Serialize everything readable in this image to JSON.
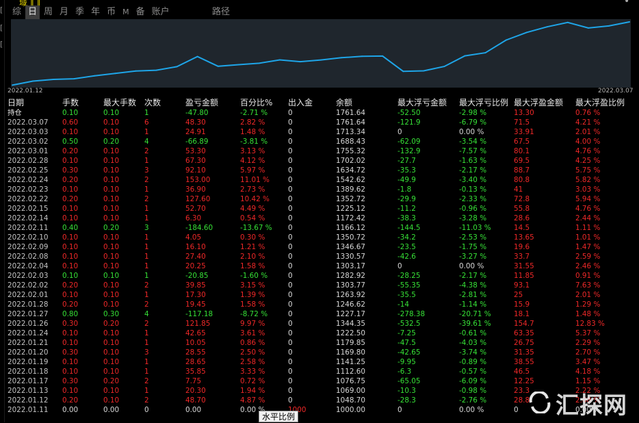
{
  "top": {
    "yellow_text": "域 ‖ ‖",
    "corner_mark": "•"
  },
  "tabs": [
    {
      "label": "综",
      "active": false
    },
    {
      "label": "日",
      "active": true
    },
    {
      "label": "周",
      "active": false
    },
    {
      "label": "月",
      "active": false
    },
    {
      "label": "季",
      "active": false
    },
    {
      "label": "年",
      "active": false
    },
    {
      "label": "币",
      "active": false
    },
    {
      "label": "M",
      "active": false
    },
    {
      "label": "备",
      "active": false
    },
    {
      "label": "账户",
      "active": false
    }
  ],
  "path_tab": "路径",
  "chart_data": {
    "type": "line",
    "x": [
      "2022.01.11",
      "2022.01.12",
      "2022.01.13",
      "2022.01.17",
      "2022.01.18",
      "2022.01.19",
      "2022.01.20",
      "2022.01.21",
      "2022.01.24",
      "2022.01.26",
      "2022.01.27",
      "2022.01.28",
      "2022.02.01",
      "2022.02.02",
      "2022.02.03",
      "2022.02.04",
      "2022.02.08",
      "2022.02.09",
      "2022.02.10",
      "2022.02.11",
      "2022.02.14",
      "2022.02.15",
      "2022.02.22",
      "2022.02.23",
      "2022.02.24",
      "2022.02.25",
      "2022.02.28",
      "2022.03.01",
      "2022.03.02",
      "2022.03.03",
      "2022.03.07"
    ],
    "values": [
      1000.0,
      1048.7,
      1069.0,
      1076.75,
      1112.6,
      1141.25,
      1169.8,
      1179.85,
      1222.5,
      1344.35,
      1227.17,
      1246.62,
      1263.92,
      1303.77,
      1282.92,
      1303.17,
      1330.57,
      1346.67,
      1350.72,
      1166.12,
      1172.42,
      1225.12,
      1352.72,
      1389.62,
      1542.62,
      1634.72,
      1702.02,
      1755.32,
      1688.43,
      1713.34,
      1761.64
    ],
    "x_start_label": "2022.01.12",
    "x_end_label": "2022.03.07",
    "ylim": [
      995,
      1770
    ],
    "line_color": "#1ea5e8",
    "background": "#1f262d"
  },
  "table": {
    "headers": [
      "日期",
      "手数",
      "最大手数",
      "次数",
      "盈亏金额",
      "百分比%",
      "出入金",
      "余额",
      "最大浮亏金额",
      "最大浮亏比例",
      "最大浮盈金额",
      "最大浮盈比例"
    ],
    "hold_row": {
      "date": "持仓",
      "lots": "0.10",
      "max_lots": "0.10",
      "count": "1",
      "pnl": "-47.80",
      "pct": "-2.71 %",
      "io": "0",
      "balance": "1761.64",
      "max_loss": "-52.50",
      "max_loss_pct": "-2.98 %",
      "max_gain": "13.30",
      "max_gain_pct": "0.76 %"
    },
    "rows": [
      {
        "date": "2022.03.07",
        "lots": "0.60",
        "max_lots": "0.10",
        "count": "6",
        "pnl": "48.30",
        "pct": "2.82 %",
        "io": "0",
        "balance": "1761.64",
        "max_loss": "-121.9",
        "max_loss_pct": "-6.79 %",
        "max_gain": "71.5",
        "max_gain_pct": "4.21 %"
      },
      {
        "date": "2022.03.03",
        "lots": "0.10",
        "max_lots": "0.10",
        "count": "1",
        "pnl": "24.91",
        "pct": "1.48 %",
        "io": "0",
        "balance": "1713.34",
        "max_loss": "0",
        "max_loss_pct": "0.00 %",
        "max_gain": "33.91",
        "max_gain_pct": "2.01 %"
      },
      {
        "date": "2022.03.02",
        "lots": "0.50",
        "max_lots": "0.20",
        "count": "4",
        "pnl": "-66.89",
        "pct": "-3.81 %",
        "io": "0",
        "balance": "1688.43",
        "max_loss": "-62.09",
        "max_loss_pct": "-3.54 %",
        "max_gain": "67.5",
        "max_gain_pct": "4.00 %"
      },
      {
        "date": "2022.03.01",
        "lots": "0.20",
        "max_lots": "0.10",
        "count": "2",
        "pnl": "53.30",
        "pct": "3.13 %",
        "io": "0",
        "balance": "1755.32",
        "max_loss": "-132.9",
        "max_loss_pct": "-7.57 %",
        "max_gain": "80.1",
        "max_gain_pct": "4.76 %"
      },
      {
        "date": "2022.02.28",
        "lots": "0.10",
        "max_lots": "0.10",
        "count": "1",
        "pnl": "67.30",
        "pct": "4.12 %",
        "io": "0",
        "balance": "1702.02",
        "max_loss": "-27.7",
        "max_loss_pct": "-1.63 %",
        "max_gain": "69.5",
        "max_gain_pct": "4.25 %"
      },
      {
        "date": "2022.02.25",
        "lots": "0.30",
        "max_lots": "0.10",
        "count": "3",
        "pnl": "92.10",
        "pct": "5.97 %",
        "io": "0",
        "balance": "1634.72",
        "max_loss": "-35.3",
        "max_loss_pct": "-2.17 %",
        "max_gain": "88.7",
        "max_gain_pct": "5.75 %"
      },
      {
        "date": "2022.02.24",
        "lots": "0.20",
        "max_lots": "0.10",
        "count": "2",
        "pnl": "153.00",
        "pct": "11.01 %",
        "io": "0",
        "balance": "1542.62",
        "max_loss": "-49.9",
        "max_loss_pct": "-3.40 %",
        "max_gain": "80.8",
        "max_gain_pct": "5.82 %"
      },
      {
        "date": "2022.02.23",
        "lots": "0.10",
        "max_lots": "0.10",
        "count": "1",
        "pnl": "36.90",
        "pct": "2.73 %",
        "io": "0",
        "balance": "1389.62",
        "max_loss": "-1.8",
        "max_loss_pct": "-0.13 %",
        "max_gain": "41",
        "max_gain_pct": "3.03 %"
      },
      {
        "date": "2022.02.22",
        "lots": "0.20",
        "max_lots": "0.10",
        "count": "2",
        "pnl": "127.60",
        "pct": "10.42 %",
        "io": "0",
        "balance": "1352.72",
        "max_loss": "-29.9",
        "max_loss_pct": "-2.33 %",
        "max_gain": "72.8",
        "max_gain_pct": "5.94 %"
      },
      {
        "date": "2022.02.15",
        "lots": "0.10",
        "max_lots": "0.10",
        "count": "1",
        "pnl": "52.70",
        "pct": "4.49 %",
        "io": "0",
        "balance": "1225.12",
        "max_loss": "-11.2",
        "max_loss_pct": "-0.96 %",
        "max_gain": "55.8",
        "max_gain_pct": "4.76 %"
      },
      {
        "date": "2022.02.14",
        "lots": "0.10",
        "max_lots": "0.10",
        "count": "1",
        "pnl": "6.30",
        "pct": "0.54 %",
        "io": "0",
        "balance": "1172.42",
        "max_loss": "-38.3",
        "max_loss_pct": "-3.28 %",
        "max_gain": "28.6",
        "max_gain_pct": "2.44 %"
      },
      {
        "date": "2022.02.11",
        "lots": "0.40",
        "max_lots": "0.20",
        "count": "3",
        "pnl": "-184.60",
        "pct": "-13.67 %",
        "io": "0",
        "balance": "1166.12",
        "max_loss": "-144.5",
        "max_loss_pct": "-11.03 %",
        "max_gain": "14.5",
        "max_gain_pct": "1.11 %"
      },
      {
        "date": "2022.02.10",
        "lots": "0.10",
        "max_lots": "0.10",
        "count": "1",
        "pnl": "4.05",
        "pct": "0.30 %",
        "io": "0",
        "balance": "1350.72",
        "max_loss": "-34.2",
        "max_loss_pct": "-2.53 %",
        "max_gain": "13.65",
        "max_gain_pct": "1.01 %"
      },
      {
        "date": "2022.02.09",
        "lots": "0.10",
        "max_lots": "0.10",
        "count": "1",
        "pnl": "16.10",
        "pct": "1.21 %",
        "io": "0",
        "balance": "1346.67",
        "max_loss": "-23.5",
        "max_loss_pct": "-1.75 %",
        "max_gain": "19.6",
        "max_gain_pct": "1.47 %"
      },
      {
        "date": "2022.02.08",
        "lots": "0.10",
        "max_lots": "0.10",
        "count": "1",
        "pnl": "27.40",
        "pct": "2.10 %",
        "io": "0",
        "balance": "1330.57",
        "max_loss": "-42.6",
        "max_loss_pct": "-3.27 %",
        "max_gain": "33.7",
        "max_gain_pct": "2.59 %"
      },
      {
        "date": "2022.02.04",
        "lots": "0.10",
        "max_lots": "0.10",
        "count": "1",
        "pnl": "20.25",
        "pct": "1.58 %",
        "io": "0",
        "balance": "1303.17",
        "max_loss": "0",
        "max_loss_pct": "0.00 %",
        "max_gain": "31.55",
        "max_gain_pct": "2.46 %"
      },
      {
        "date": "2022.02.03",
        "lots": "0.10",
        "max_lots": "0.10",
        "count": "1",
        "pnl": "-20.85",
        "pct": "-1.60 %",
        "io": "0",
        "balance": "1282.92",
        "max_loss": "-28.25",
        "max_loss_pct": "-2.17 %",
        "max_gain": "11.85",
        "max_gain_pct": "0.91 %"
      },
      {
        "date": "2022.02.02",
        "lots": "0.20",
        "max_lots": "0.10",
        "count": "2",
        "pnl": "39.85",
        "pct": "3.15 %",
        "io": "0",
        "balance": "1303.77",
        "max_loss": "-55.35",
        "max_loss_pct": "-4.38 %",
        "max_gain": "93.1",
        "max_gain_pct": "7.63 %"
      },
      {
        "date": "2022.02.01",
        "lots": "0.10",
        "max_lots": "0.10",
        "count": "1",
        "pnl": "17.30",
        "pct": "1.39 %",
        "io": "0",
        "balance": "1263.92",
        "max_loss": "-35.5",
        "max_loss_pct": "-2.81 %",
        "max_gain": "25",
        "max_gain_pct": "2.01 %"
      },
      {
        "date": "2022.01.28",
        "lots": "0.20",
        "max_lots": "0.10",
        "count": "2",
        "pnl": "19.45",
        "pct": "1.58 %",
        "io": "0",
        "balance": "1246.62",
        "max_loss": "-14",
        "max_loss_pct": "-1.14 %",
        "max_gain": "15.9",
        "max_gain_pct": "1.29 %"
      },
      {
        "date": "2022.01.27",
        "lots": "0.80",
        "max_lots": "0.30",
        "count": "4",
        "pnl": "-117.18",
        "pct": "-8.72 %",
        "io": "0",
        "balance": "1227.17",
        "max_loss": "-278.38",
        "max_loss_pct": "-20.71 %",
        "max_gain": "18.1",
        "max_gain_pct": "1.48 %"
      },
      {
        "date": "2022.01.26",
        "lots": "0.30",
        "max_lots": "0.20",
        "count": "2",
        "pnl": "121.85",
        "pct": "9.97 %",
        "io": "0",
        "balance": "1344.35",
        "max_loss": "-532.5",
        "max_loss_pct": "-39.61 %",
        "max_gain": "154.7",
        "max_gain_pct": "12.83 %"
      },
      {
        "date": "2022.01.24",
        "lots": "0.10",
        "max_lots": "0.10",
        "count": "1",
        "pnl": "42.65",
        "pct": "3.61 %",
        "io": "0",
        "balance": "1222.50",
        "max_loss": "-7.25",
        "max_loss_pct": "-0.61 %",
        "max_gain": "63.35",
        "max_gain_pct": "5.37 %"
      },
      {
        "date": "2022.01.21",
        "lots": "0.10",
        "max_lots": "0.10",
        "count": "1",
        "pnl": "10.05",
        "pct": "0.86 %",
        "io": "0",
        "balance": "1179.85",
        "max_loss": "-47.5",
        "max_loss_pct": "-4.03 %",
        "max_gain": "26.75",
        "max_gain_pct": "2.29 %"
      },
      {
        "date": "2022.01.20",
        "lots": "0.30",
        "max_lots": "0.10",
        "count": "3",
        "pnl": "28.55",
        "pct": "2.50 %",
        "io": "0",
        "balance": "1169.80",
        "max_loss": "-42.65",
        "max_loss_pct": "-3.74 %",
        "max_gain": "31.35",
        "max_gain_pct": "2.70 %"
      },
      {
        "date": "2022.01.19",
        "lots": "0.10",
        "max_lots": "0.10",
        "count": "1",
        "pnl": "28.65",
        "pct": "2.58 %",
        "io": "0",
        "balance": "1141.25",
        "max_loss": "-9.95",
        "max_loss_pct": "-0.89 %",
        "max_gain": "38.55",
        "max_gain_pct": "3.47 %"
      },
      {
        "date": "2022.01.18",
        "lots": "0.10",
        "max_lots": "0.10",
        "count": "1",
        "pnl": "35.85",
        "pct": "3.33 %",
        "io": "0",
        "balance": "1112.60",
        "max_loss": "-6.3",
        "max_loss_pct": "-0.57 %",
        "max_gain": "46.5",
        "max_gain_pct": "4.18 %"
      },
      {
        "date": "2022.01.17",
        "lots": "0.30",
        "max_lots": "0.20",
        "count": "2",
        "pnl": "7.75",
        "pct": "0.72 %",
        "io": "0",
        "balance": "1076.75",
        "max_loss": "-65.05",
        "max_loss_pct": "-6.09 %",
        "max_gain": "12.25",
        "max_gain_pct": "1.15 %"
      },
      {
        "date": "2022.01.13",
        "lots": "0.10",
        "max_lots": "0.10",
        "count": "1",
        "pnl": "20.30",
        "pct": "1.94 %",
        "io": "0",
        "balance": "1069.00",
        "max_loss": "-10.3",
        "max_loss_pct": "-0.98 %",
        "max_gain": "23.3",
        "max_gain_pct": "2.22 %"
      },
      {
        "date": "2022.01.12",
        "lots": "0.20",
        "max_lots": "0.10",
        "count": "2",
        "pnl": "48.70",
        "pct": "4.87 %",
        "io": "0",
        "balance": "1048.70",
        "max_loss": "-28.3",
        "max_loss_pct": "-2.76 %",
        "max_gain": "28.8",
        "max_gain_pct": "2.88 %"
      },
      {
        "date": "2022.01.11",
        "lots": "0.00",
        "max_lots": "0.00",
        "count": "0",
        "pnl": "0.00",
        "pct": "0.00 %",
        "io": "1000",
        "balance": "1000.00",
        "max_loss": "0",
        "max_loss_pct": "0.00 %",
        "max_gain": "0",
        "max_gain_pct": "0.00 %"
      }
    ]
  },
  "tooltip": "水平比例",
  "watermark": "汇探网",
  "colors": {
    "gain": "#ee2828",
    "loss": "#36e036",
    "neutral": "#d8d8d8",
    "line": "#1ea5e8"
  }
}
